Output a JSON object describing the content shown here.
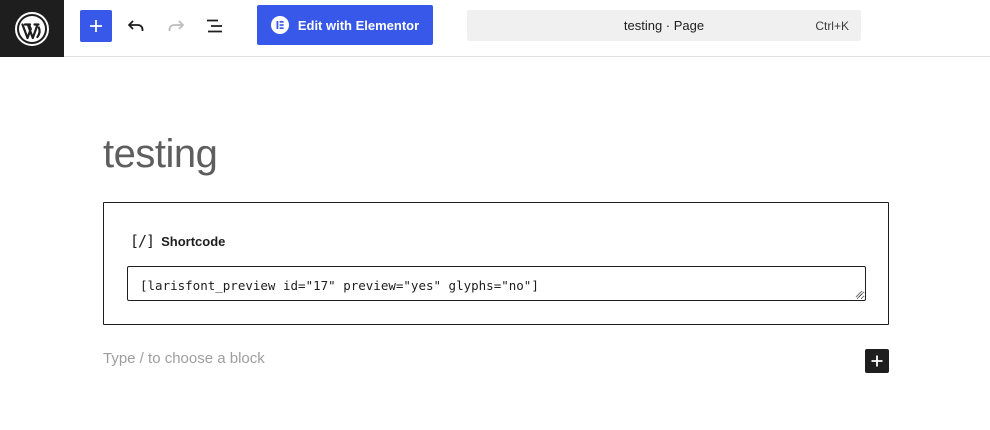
{
  "toolbar": {
    "add_block_icon": "plus-icon",
    "undo_icon": "undo-icon",
    "redo_icon": "redo-icon",
    "document_overview_icon": "list-view-icon",
    "elementor_button_label": "Edit with Elementor",
    "colors": {
      "logo_bg": "#1e1e1e",
      "accent": "#3858e9"
    }
  },
  "command_bar": {
    "title": "testing · Page",
    "shortcut": "Ctrl+K"
  },
  "post": {
    "title": "testing"
  },
  "shortcode_block": {
    "icon": "[/]",
    "label": "Shortcode",
    "value": "[larisfont_preview id=\"17\" preview=\"yes\" glyphs=\"no\"]"
  },
  "appender": {
    "placeholder": "Type / to choose a block",
    "button_icon": "plus-icon"
  }
}
